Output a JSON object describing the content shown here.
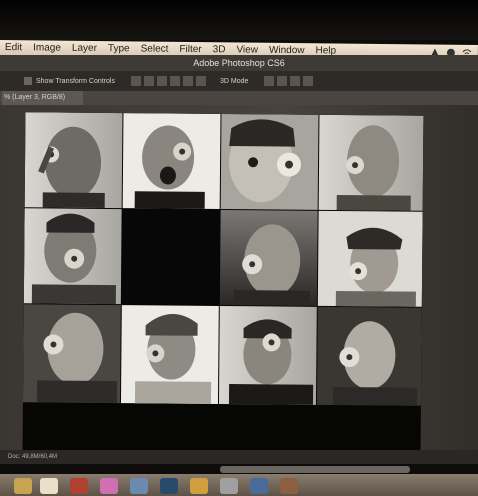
{
  "menu": {
    "items": [
      "Edit",
      "Image",
      "Layer",
      "Type",
      "Select",
      "Filter",
      "3D",
      "View",
      "Window",
      "Help"
    ],
    "icons": [
      "creative-cloud-icon",
      "ps-menu-icon",
      "wifi-icon"
    ]
  },
  "window": {
    "title": "Adobe Photoshop CS6"
  },
  "options": {
    "show_transform": "Show Transform Controls",
    "mode_3d": "3D Mode"
  },
  "document": {
    "tab_label": "% (Layer 3, RGB/8)"
  },
  "status": {
    "doc_size": "Doc: 49,8M/60,4M"
  },
  "colors": {
    "menubar": "#e8dbc6",
    "titlebar": "#3e3a35",
    "workspace": "#403c37",
    "canvas": "#060605"
  },
  "photos": [
    {
      "id": "p1"
    },
    {
      "id": "p2"
    },
    {
      "id": "p3"
    },
    {
      "id": "p4"
    },
    {
      "id": "p5"
    },
    {
      "id": "empty"
    },
    {
      "id": "p6"
    },
    {
      "id": "p7"
    },
    {
      "id": "p8"
    },
    {
      "id": "p9"
    },
    {
      "id": "p10"
    },
    {
      "id": "p11"
    }
  ]
}
